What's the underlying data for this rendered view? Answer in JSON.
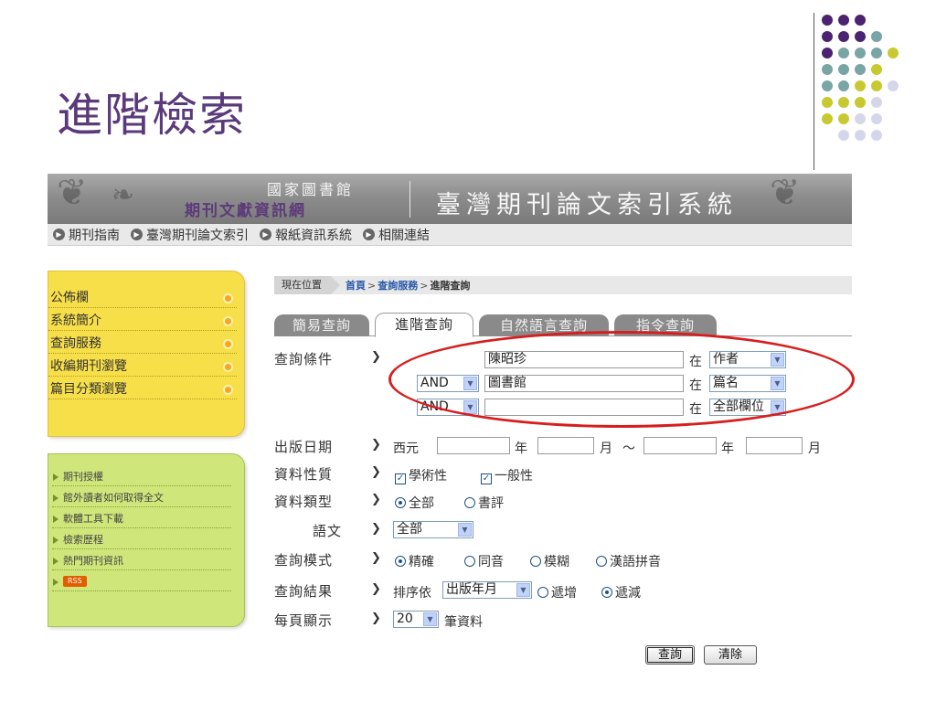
{
  "slide": {
    "title": "進階檢索"
  },
  "banner": {
    "library_name": "國家圖書館",
    "network_name": "期刊文獻資訊網",
    "system_name": "臺灣期刊論文索引系統"
  },
  "top_nav": [
    {
      "label": "期刊指南"
    },
    {
      "label": "臺灣期刊論文索引"
    },
    {
      "label": "報紙資訊系統"
    },
    {
      "label": "相關連結"
    }
  ],
  "sidebar_primary": [
    {
      "label": "公佈欄"
    },
    {
      "label": "系統簡介"
    },
    {
      "label": "查詢服務"
    },
    {
      "label": "收編期刊瀏覽"
    },
    {
      "label": "篇目分類瀏覽"
    }
  ],
  "sidebar_secondary": [
    {
      "label": "期刊授權"
    },
    {
      "label": "館外讀者如何取得全文"
    },
    {
      "label": "軟體工具下載"
    },
    {
      "label": "檢索歷程"
    },
    {
      "label": "熱門期刊資訊"
    }
  ],
  "rss_label": "RSS",
  "breadcrumb": {
    "here": "現在位置",
    "home": "首頁",
    "service": "查詢服務",
    "current": "進階查詢",
    "sep": ">"
  },
  "tabs": [
    {
      "label": "簡易查詢"
    },
    {
      "label": "進階查詢"
    },
    {
      "label": "自然語言查詢"
    },
    {
      "label": "指令查詢"
    }
  ],
  "form": {
    "query_label": "查詢條件",
    "in_label": "在",
    "rows": [
      {
        "value": "陳昭珍",
        "field": "作者"
      },
      {
        "op": "AND",
        "value": "圖書館",
        "field": "篇名"
      },
      {
        "op": "AND",
        "value": "",
        "field": "全部欄位"
      }
    ],
    "date_label": "出版日期",
    "date_era": "西元",
    "year_unit": "年",
    "month_unit": "月",
    "date_tilde": "～",
    "nature_label": "資料性質",
    "nature_academic": "學術性",
    "nature_general": "一般性",
    "type_label": "資料類型",
    "type_all": "全部",
    "type_review": "書評",
    "lang_label": "語文",
    "lang_value": "全部",
    "mode_label": "查詢模式",
    "mode_exact": "精確",
    "mode_homophone": "同音",
    "mode_fuzzy": "模糊",
    "mode_pinyin": "漢語拼音",
    "result_label": "查詢結果",
    "sort_by": "排序依",
    "sort_field": "出版年月",
    "sort_asc": "遞增",
    "sort_desc": "遞減",
    "page_label": "每頁顯示",
    "page_size": "20",
    "page_unit": "筆資料",
    "search_button": "查詢",
    "clear_button": "清除"
  },
  "colors": {
    "title": "#5a3a7a",
    "highlight_oval": "#d71e1e",
    "panel_yellow": "#f7df4a",
    "panel_green": "#cfe67a"
  }
}
